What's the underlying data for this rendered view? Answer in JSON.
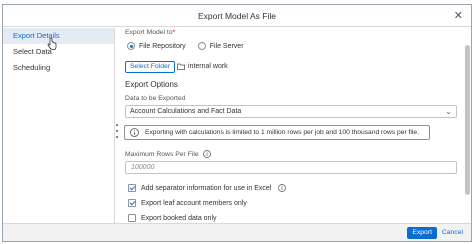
{
  "dialog": {
    "title": "Export Model As File"
  },
  "sidebar": {
    "items": [
      {
        "label": "Export Details",
        "active": true
      },
      {
        "label": "Select Data"
      },
      {
        "label": "Scheduling"
      }
    ]
  },
  "export_model_to": {
    "label": "Export Model to",
    "required_marker": "*",
    "options": [
      "File Repository",
      "File Server"
    ],
    "selected": "File Repository"
  },
  "select_folder": {
    "button_label": "Select Folder",
    "path": "internal work"
  },
  "export_options": {
    "heading": "Export Options",
    "data_label": "Data to be Exported",
    "data_value": "Account Calculations and Fact Data",
    "info_text": "Exporting with calculations is limited to 1 million rows per job and 100 thousand rows per file.",
    "max_rows_label": "Maximum Rows Per File",
    "max_rows_placeholder": "100000",
    "checkboxes": [
      {
        "label": "Add separator information for use in Excel",
        "checked": true
      },
      {
        "label": "Export leaf account members only",
        "checked": true
      },
      {
        "label": "Export booked data only",
        "checked": false
      }
    ]
  },
  "footer": {
    "primary_label": "Export",
    "secondary_label": "Cancel"
  },
  "colors": {
    "accent": "#0a6ed1",
    "active_nav_bg": "#e4ebf3"
  }
}
